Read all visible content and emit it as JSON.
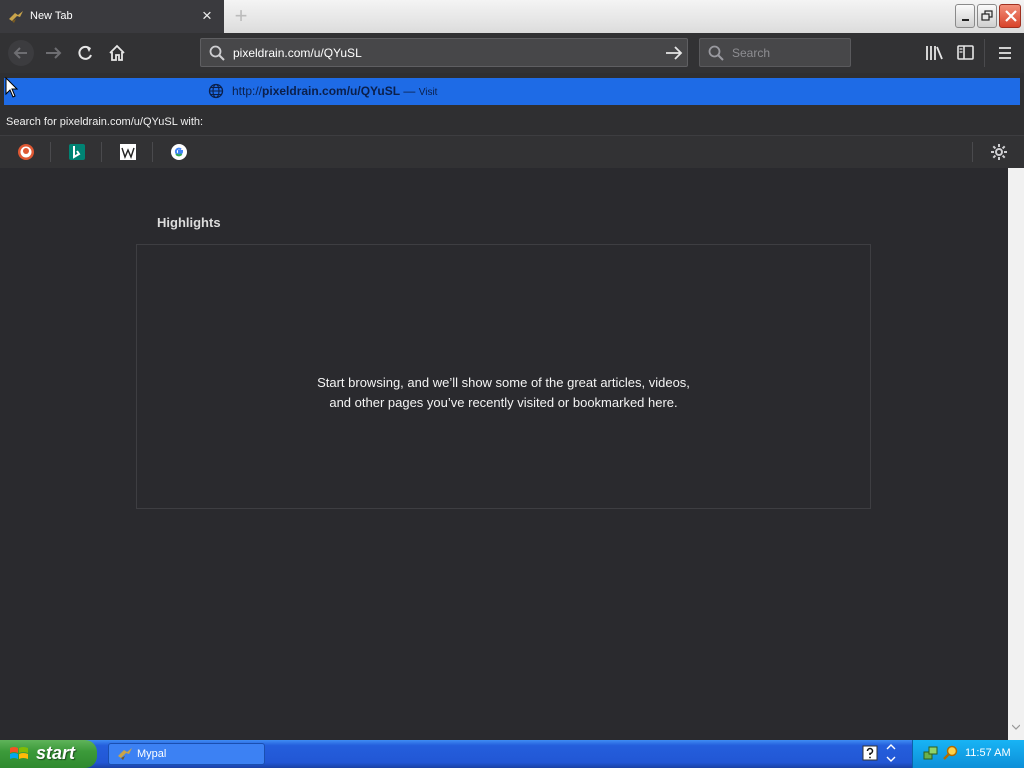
{
  "window": {
    "tab_title": "New Tab",
    "new_tab_symbol": "+",
    "tab_close_symbol": "×"
  },
  "nav": {
    "url": "pixeldrain.com/u/QYuSL",
    "search_placeholder": "Search"
  },
  "autocomplete": {
    "suggestion_prefix": "http://",
    "suggestion_bold": "pixeldrain.com/u/QYuSL",
    "suggestion_dash": " — ",
    "suggestion_action": "Visit",
    "search_with": "Search for pixeldrain.com/u/QYuSL with:",
    "engines": [
      "duckduckgo-icon",
      "bing-icon",
      "wikipedia-icon",
      "google-icon"
    ]
  },
  "content": {
    "section_title": "Highlights",
    "empty_message": "Start browsing, and we’ll show some of the great articles, videos, and other pages you’ve recently visited or bookmarked here."
  },
  "taskbar": {
    "start_label": "start",
    "task_label": "Mypal",
    "clock": "11:57 AM"
  },
  "colors": {
    "accent": "#1e6be6",
    "content_bg": "#2a2a2e",
    "taskbar": "#245edc",
    "start": "#3c9a3a"
  }
}
